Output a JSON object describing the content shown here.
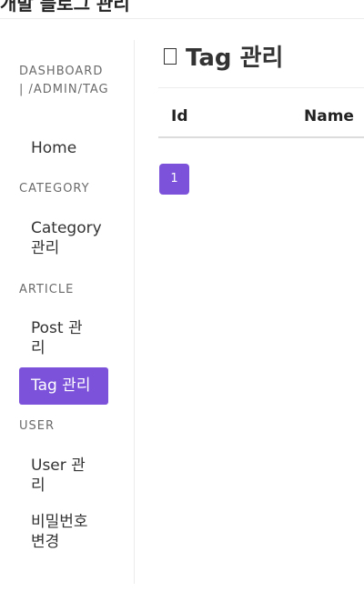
{
  "topbar": {
    "brand": "개발 블로그 관리"
  },
  "sidebar": {
    "sections": [
      {
        "label": "DASHBOARD | /ADMIN/TAG",
        "items": [
          {
            "label": "Home"
          }
        ]
      },
      {
        "label": "CATEGORY",
        "items": [
          {
            "label": "Category 관리"
          }
        ]
      },
      {
        "label": "ARTICLE",
        "items": [
          {
            "label": "Post 관리"
          },
          {
            "label": "Tag 관리",
            "active": true
          }
        ]
      },
      {
        "label": "USER",
        "items": [
          {
            "label": "User 관리"
          },
          {
            "label": "비밀번호 변경"
          }
        ]
      }
    ]
  },
  "main": {
    "title": "Tag 관리",
    "title_icon": "square-icon",
    "table": {
      "columns": [
        "Id",
        "Name"
      ],
      "rows": []
    },
    "pagination": {
      "current_page": "1"
    }
  },
  "colors": {
    "accent": "#7b52d9"
  }
}
